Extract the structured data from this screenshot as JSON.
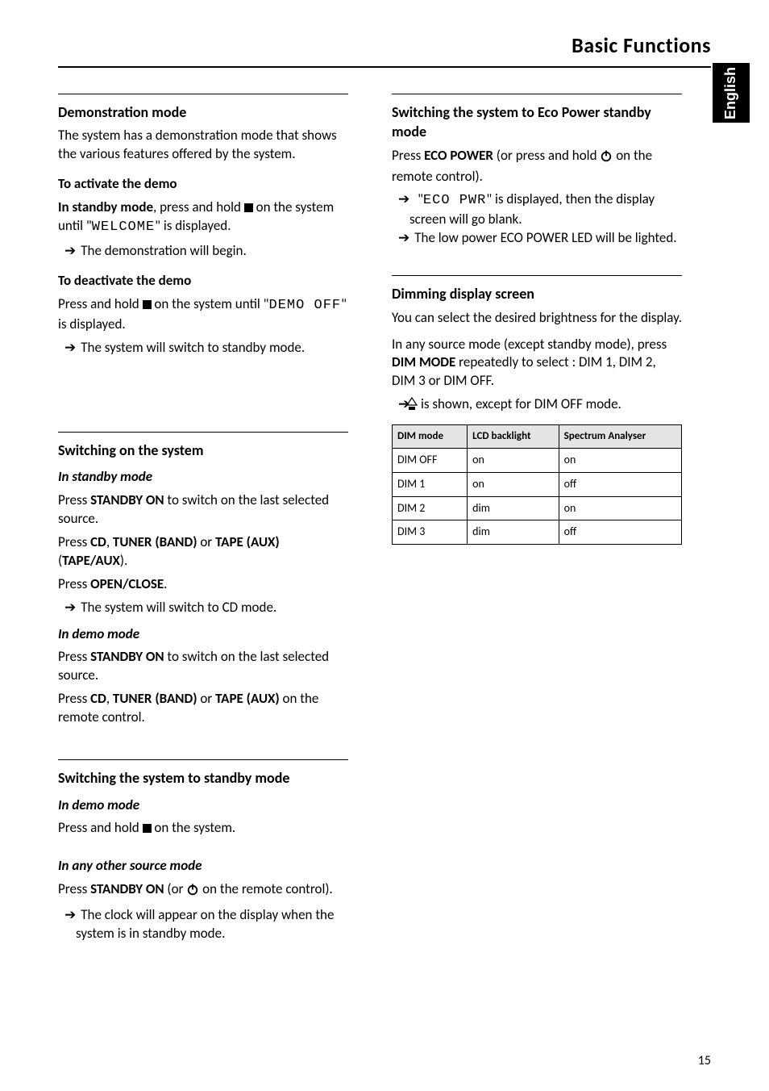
{
  "header": {
    "title": "Basic Functions"
  },
  "sidebar": {
    "label": "English"
  },
  "left": {
    "demo": {
      "title": "Demonstration mode",
      "intro": "The system has a demonstration mode that shows the various features offered by the system.",
      "activate_title": "To activate the demo",
      "activate_1a": "In standby mode",
      "activate_1b": ", press and hold ",
      "activate_1c": " on the system until \"",
      "activate_display": "WELCOME",
      "activate_1d": "\" is displayed.",
      "activate_result": "The demonstration will begin.",
      "deactivate_title": "To deactivate the demo",
      "deactivate_1a": "Press and hold ",
      "deactivate_1b": " on the system until \"",
      "deactivate_display": "DEMO OFF",
      "deactivate_1c": "\" is displayed.",
      "deactivate_result": "The system will switch to standby mode."
    },
    "switchon": {
      "title": "Switching on the system",
      "in_standby_title": "In standby mode",
      "s1_press": "Press ",
      "s1_btn": "STANDBY ON",
      "s1_rest": " to switch on the last selected source.",
      "s2_press": "Press ",
      "s2_b1": "CD",
      "s2_sep": ", ",
      "s2_b2": "TUNER (BAND)",
      "s2_or": " or ",
      "s2_b3": "TAPE (AUX)",
      "s2_paren_open": " (",
      "s2_b3b": "TAPE/AUX",
      "s2_paren_close": ").",
      "s3_press": "Press ",
      "s3_btn": "OPEN/CLOSE",
      "s3_dot": ".",
      "s3_result": "The system will switch to CD mode.",
      "in_demo_title": "In demo mode",
      "d1_press": "Press ",
      "d1_btn": "STANDBY ON",
      "d1_rest": " to switch on the last selected source.",
      "d2_press": "Press ",
      "d2_b1": "CD",
      "d2_sep": ", ",
      "d2_b2": "TUNER (BAND)",
      "d2_or": " or ",
      "d2_b3": "TAPE (AUX)",
      "d2_rest": " on the remote control."
    },
    "standby": {
      "title": "Switching the system to standby mode",
      "demo_title": "In demo mode",
      "demo_line_a": "Press and hold ",
      "demo_line_b": " on the system.",
      "any_title": "In any other source mode",
      "any_press": "Press ",
      "any_btn": "STANDBY ON",
      "any_mid": " (or ",
      "any_end": " on the remote control).",
      "any_result": "The clock will appear on the display when the system is in standby mode."
    }
  },
  "right": {
    "eco": {
      "title": "Switching the system to Eco Power standby mode",
      "p_press": "Press ",
      "p_btn": "ECO POWER",
      "p_mid": " (or press and hold ",
      "p_end": " on the remote control).",
      "r1a": "\"",
      "r1_display": "ECO PWR",
      "r1b": "\" is displayed, then the display screen will go blank.",
      "r2": "The low power ECO POWER LED will be lighted."
    },
    "dim": {
      "title": "Dimming display screen",
      "intro": "You can select the desired brightness for the display.",
      "p1a": "In any source mode (except standby mode), press ",
      "p1_btn": "DIM MODE",
      "p1b": " repeatedly to select : DIM 1, DIM 2, DIM 3 or DIM OFF.",
      "result_tail": " is shown, except for DIM OFF mode."
    }
  },
  "chart_data": {
    "type": "table",
    "title": "DIM mode / LCD backlight / Spectrum Analyser",
    "columns": [
      "DIM mode",
      "LCD backlight",
      "Spectrum Analyser"
    ],
    "rows": [
      {
        "mode": "DIM OFF",
        "lcd": "on",
        "spec": "on"
      },
      {
        "mode": "DIM 1",
        "lcd": "on",
        "spec": "off"
      },
      {
        "mode": "DIM 2",
        "lcd": "dim",
        "spec": "on"
      },
      {
        "mode": "DIM 3",
        "lcd": "dim",
        "spec": "off"
      }
    ]
  },
  "page_number": "15"
}
